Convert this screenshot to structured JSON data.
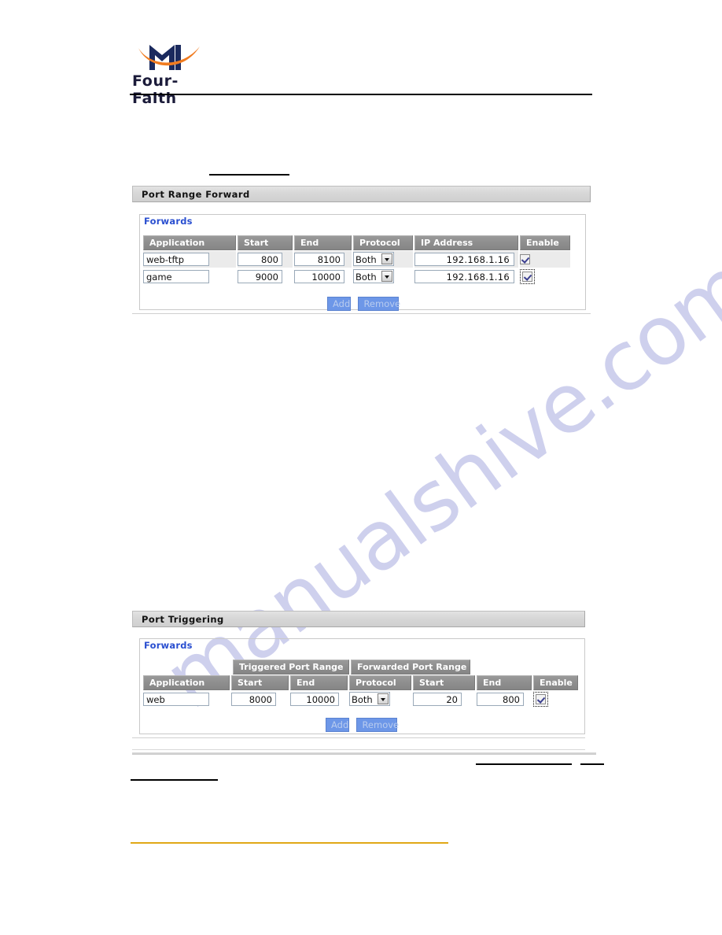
{
  "brand": {
    "name": "Four-Faith",
    "logo_icon": "four-faith-m-logo",
    "logo_colors": {
      "mark": "#1b2a5e",
      "swoosh": "#f07b20"
    }
  },
  "watermark": {
    "text": "manualshive.com",
    "color": "#c6c8ea"
  },
  "sections": [
    {
      "id": "port_range_forward",
      "title": "Port Range Forward",
      "fieldset_legend": "Forwards",
      "columns": [
        "Application",
        "Start",
        "End",
        "Protocol",
        "IP Address",
        "Enable"
      ],
      "rows": [
        {
          "application": "web-tftp",
          "start": "800",
          "end": "8100",
          "protocol": "Both",
          "ip_address": "192.168.1.16",
          "enable": true,
          "enable_focused": false
        },
        {
          "application": "game",
          "start": "9000",
          "end": "10000",
          "protocol": "Both",
          "ip_address": "192.168.1.16",
          "enable": true,
          "enable_focused": true
        }
      ],
      "buttons": {
        "add": "Add",
        "remove": "Remove"
      }
    },
    {
      "id": "port_triggering",
      "title": "Port Triggering",
      "fieldset_legend": "Forwards",
      "group_headers": [
        "Triggered Port Range",
        "Forwarded Port Range"
      ],
      "columns": [
        "Application",
        "Start",
        "End",
        "Protocol",
        "Start",
        "End",
        "Enable"
      ],
      "rows": [
        {
          "application": "web",
          "trigger_start": "8000",
          "trigger_end": "10000",
          "protocol": "Both",
          "forward_start": "20",
          "forward_end": "800",
          "enable": true,
          "enable_focused": true
        }
      ],
      "buttons": {
        "add": "Add",
        "remove": "Remove"
      }
    }
  ],
  "colors": {
    "header_bar": "#d7d7d7",
    "table_header": "#8e8e8e",
    "legend_blue": "#2a4fd0",
    "button_blue": "#6d97e8",
    "gold_rule": "#e0a817"
  }
}
